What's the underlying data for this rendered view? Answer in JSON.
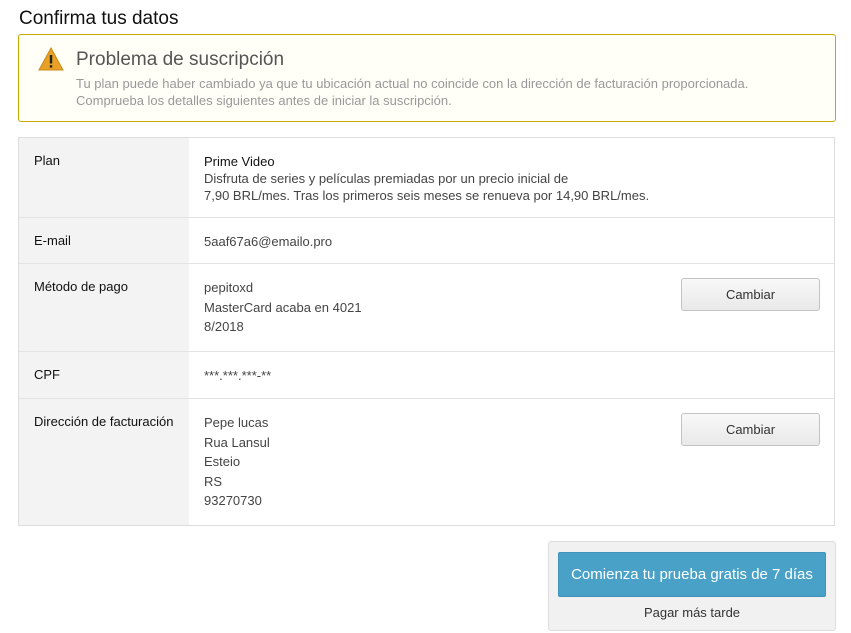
{
  "page": {
    "title": "Confirma tus datos"
  },
  "alert": {
    "title": "Problema de suscripción",
    "line1": "Tu plan puede haber cambiado ya que tu ubicación actual no coincide con la dirección de facturación proporcionada.",
    "line2": "Comprueba los detalles siguientes antes de iniciar la suscripción.",
    "icon": "warning-icon",
    "color": "#e8a126"
  },
  "details": {
    "plan": {
      "label": "Plan",
      "name": "Prime Video",
      "desc_line1": "Disfruta de series y películas premiadas por un precio inicial de",
      "desc_line2": "7,90 BRL/mes. Tras los primeros seis meses se renueva por 14,90 BRL/mes."
    },
    "email": {
      "label": "E-mail",
      "value": "5aaf67a6@emailo.pro"
    },
    "payment": {
      "label": "Método de pago",
      "holder": "pepitoxd",
      "card": "MasterCard acaba en 4021",
      "expiry": "8/2018",
      "change_label": "Cambiar"
    },
    "cpf": {
      "label": "CPF",
      "value": "***.***.***-**"
    },
    "billing": {
      "label": "Dirección de facturación",
      "name": "Pepe lucas",
      "street": "Rua Lansul",
      "city": "Esteio",
      "state": "RS",
      "zip": "93270730",
      "change_label": "Cambiar"
    }
  },
  "cta": {
    "start_label": "Comienza tu prueba gratis de 7 días",
    "later_label": "Pagar más tarde",
    "color": "#4aa1c8"
  }
}
